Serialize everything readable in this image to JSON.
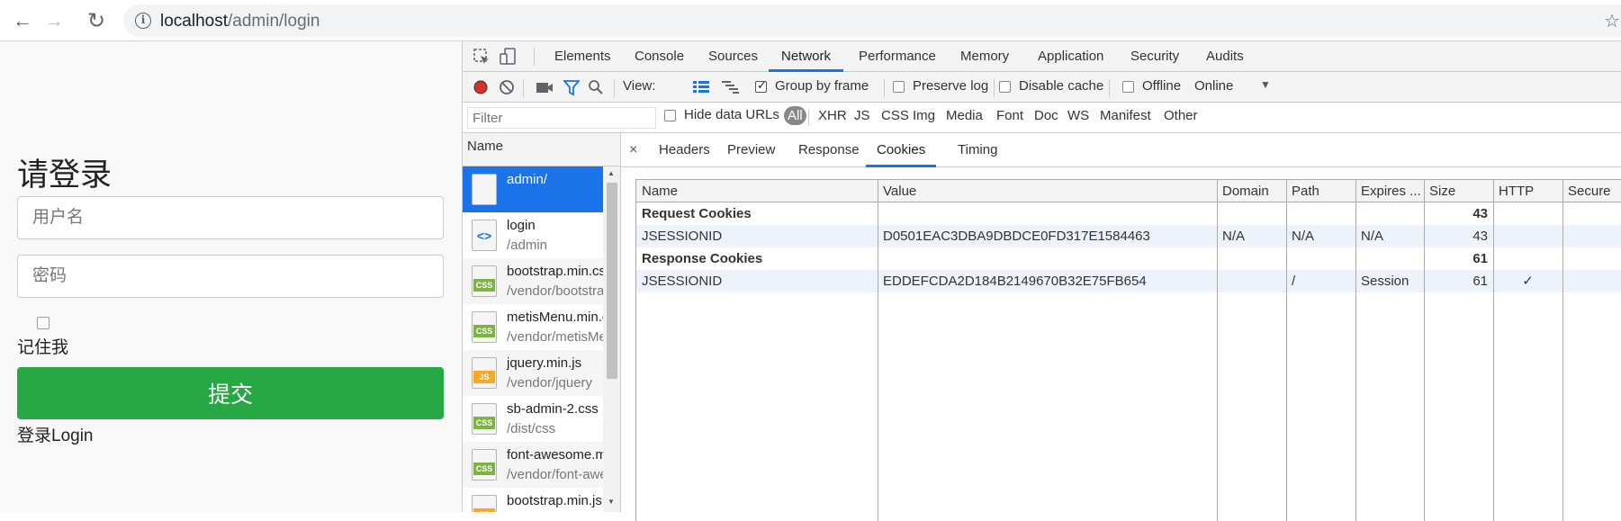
{
  "browser": {
    "url_host": "localhost",
    "url_path": "/admin/login"
  },
  "login": {
    "title": "请登录",
    "username_placeholder": "用户名",
    "password_placeholder": "密码",
    "remember_label": "记住我",
    "submit_label": "提交",
    "footer_text": "登录Login"
  },
  "devtools": {
    "tabs": [
      "Elements",
      "Console",
      "Sources",
      "Network",
      "Performance",
      "Memory",
      "Application",
      "Security",
      "Audits"
    ],
    "selected_tab": "Network",
    "toolbar": {
      "view_label": "View:",
      "group_by_frame": "Group by frame",
      "preserve_log": "Preserve log",
      "disable_cache": "Disable cache",
      "offline": "Offline",
      "throttle": "Online"
    },
    "filter": {
      "placeholder": "Filter",
      "hide_data_urls": "Hide data URLs",
      "types": [
        "All",
        "XHR",
        "JS",
        "CSS",
        "Img",
        "Media",
        "Font",
        "Doc",
        "WS",
        "Manifest",
        "Other"
      ]
    },
    "requests_header": "Name",
    "requests": [
      {
        "name": "admin/",
        "path": "",
        "type": "doc",
        "selected": true
      },
      {
        "name": "login",
        "path": "/admin",
        "type": "html",
        "selected": false
      },
      {
        "name": "bootstrap.min.css",
        "path": "/vendor/bootstrap/css",
        "type": "CSS",
        "selected": false
      },
      {
        "name": "metisMenu.min.css",
        "path": "/vendor/metisMenu",
        "type": "CSS",
        "selected": false
      },
      {
        "name": "jquery.min.js",
        "path": "/vendor/jquery",
        "type": "JS",
        "selected": false
      },
      {
        "name": "sb-admin-2.css",
        "path": "/dist/css",
        "type": "CSS",
        "selected": false
      },
      {
        "name": "font-awesome.min.css",
        "path": "/vendor/font-awesome/css",
        "type": "CSS",
        "selected": false
      },
      {
        "name": "bootstrap.min.js",
        "path": "",
        "type": "JS",
        "selected": false
      }
    ],
    "detail_tabs": [
      "Headers",
      "Preview",
      "Response",
      "Cookies",
      "Timing"
    ],
    "selected_detail_tab": "Cookies",
    "cookie_columns": [
      "Name",
      "Value",
      "Domain",
      "Path",
      "Expires ...",
      "Size",
      "HTTP",
      "Secure"
    ],
    "cookie_rows": [
      {
        "kind": "group",
        "name": "Request Cookies",
        "size": "43"
      },
      {
        "kind": "cookie",
        "name": "JSESSIONID",
        "value": "D0501EAC3DBA9DBDCE0FD317E1584463",
        "domain": "N/A",
        "path": "N/A",
        "expires": "N/A",
        "size": "43",
        "http": ""
      },
      {
        "kind": "group",
        "name": "Response Cookies",
        "size": "61"
      },
      {
        "kind": "cookie",
        "name": "JSESSIONID",
        "value": "EDDEFCDA2D184B2149670B32E75FB654",
        "domain": "",
        "path": "/",
        "expires": "Session",
        "size": "61",
        "http": "✓"
      }
    ]
  }
}
